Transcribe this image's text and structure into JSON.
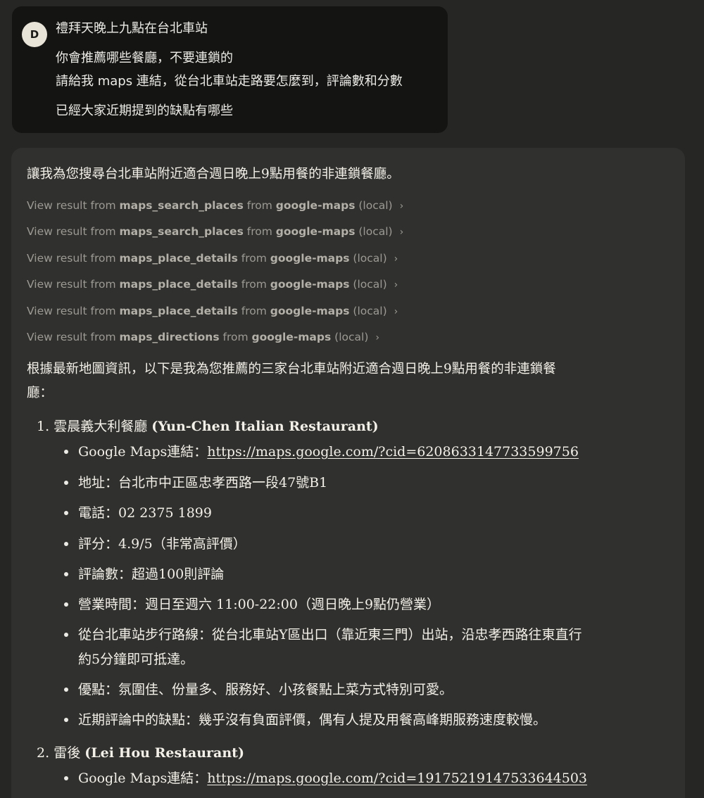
{
  "user": {
    "avatar_initial": "D",
    "lines": [
      "禮拜天晚上九點在台北車站",
      "你會推薦哪些餐廳，不要連鎖的",
      "請給我 maps 連結，從台北車站走路要怎麼到，評論數和分數",
      "已經大家近期提到的缺點有哪些"
    ]
  },
  "assistant": {
    "intro": "讓我為您搜尋台北車站附近適合週日晚上9點用餐的非連鎖餐廳。",
    "tool_results": [
      {
        "prefix": "View result from",
        "tool": "maps_search_places",
        "mid": "from",
        "server": "google-maps",
        "suffix": "(local)"
      },
      {
        "prefix": "View result from",
        "tool": "maps_search_places",
        "mid": "from",
        "server": "google-maps",
        "suffix": "(local)"
      },
      {
        "prefix": "View result from",
        "tool": "maps_place_details",
        "mid": "from",
        "server": "google-maps",
        "suffix": "(local)"
      },
      {
        "prefix": "View result from",
        "tool": "maps_place_details",
        "mid": "from",
        "server": "google-maps",
        "suffix": "(local)"
      },
      {
        "prefix": "View result from",
        "tool": "maps_place_details",
        "mid": "from",
        "server": "google-maps",
        "suffix": "(local)"
      },
      {
        "prefix": "View result from",
        "tool": "maps_directions",
        "mid": "from",
        "server": "google-maps",
        "suffix": "(local)"
      }
    ],
    "summary_line1": "根據最新地圖資訊，以下是我為您推薦的三家台北車站附近適合週日晚上9點用餐的非連鎖餐",
    "summary_line2": "廳：",
    "restaurants": [
      {
        "number": "1.",
        "name": "雲晨義大利餐廳",
        "name_en": "(Yun-Chen Italian Restaurant)",
        "maps_label": "Google Maps連結：",
        "maps_url": "https://maps.google.com/?cid=6208633147733599756",
        "address": "地址：台北市中正區忠孝西路一段47號B1",
        "phone": "電話：02 2375 1899",
        "rating": "評分：4.9/5（非常高評價）",
        "reviews": "評論數：超過100則評論",
        "hours": "營業時間：週日至週六 11:00-22:00（週日晚上9點仍營業）",
        "route_line1": "從台北車站步行路線：從台北車站Y區出口（靠近東三門）出站，沿忠孝西路往東直行",
        "route_line2": "約5分鐘即可抵達。",
        "pros": "優點：氛圍佳、份量多、服務好、小孩餐點上菜方式特別可愛。",
        "cons": "近期評論中的缺點：幾乎沒有負面評價，偶有人提及用餐高峰期服務速度較慢。"
      },
      {
        "number": "2.",
        "name": "雷後",
        "name_en": "(Lei Hou Restaurant)",
        "maps_label": "Google Maps連結：",
        "maps_url": "https://maps.google.com/?cid=19175219147533644503"
      }
    ]
  },
  "colors": {
    "page_bg": "#262624",
    "user_bubble": "#141413",
    "assistant_bubble": "#30302e",
    "muted_text": "#9c9a93"
  }
}
